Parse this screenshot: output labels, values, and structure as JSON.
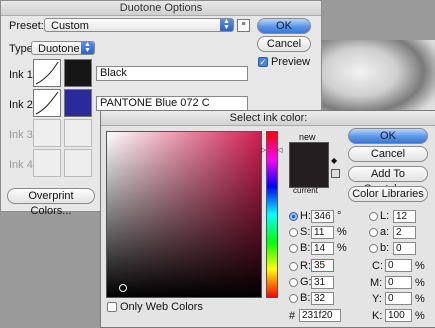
{
  "duotone": {
    "title": "Duotone Options",
    "preset_label": "Preset:",
    "preset_value": "Custom",
    "type_label": "Type:",
    "type_value": "Duotone",
    "ink1_label": "Ink 1:",
    "ink1_name": "Black",
    "ink2_label": "Ink 2:",
    "ink2_name": "PANTONE Blue 072 C",
    "ink3_label": "Ink 3:",
    "ink4_label": "Ink 4:",
    "ok": "OK",
    "cancel": "Cancel",
    "preview_label": "Preview",
    "preview_checked": true,
    "overprint": "Overprint Colors..."
  },
  "picker": {
    "title": "Select ink color:",
    "new_label": "new",
    "current_label": "current",
    "ok": "OK",
    "cancel": "Cancel",
    "add_swatches": "Add To Swatches",
    "color_libraries": "Color Libraries",
    "only_web": "Only Web Colors",
    "hsb": {
      "H_label": "H:",
      "H": "346",
      "H_unit": "°",
      "S_label": "S:",
      "S": "11",
      "S_unit": "%",
      "B_label": "B:",
      "B": "14",
      "B_unit": "%"
    },
    "rgb": {
      "R_label": "R:",
      "R": "35",
      "G_label": "G:",
      "G": "31",
      "B_label": "B:",
      "B": "32"
    },
    "lab": {
      "L_label": "L:",
      "L": "12",
      "a_label": "a:",
      "a": "2",
      "b_label": "b:",
      "b": "0"
    },
    "cmyk": {
      "C_label": "C:",
      "C": "0",
      "M_label": "M:",
      "M": "0",
      "Y_label": "Y:",
      "Y": "0",
      "K_label": "K:",
      "K": "100",
      "unit": "%"
    },
    "hex_label": "#",
    "hex": "231f20",
    "new_color": "#231f20",
    "current_color": "#231f20"
  },
  "colors": {
    "ink1": "#161616",
    "ink2": "#2a2a9a",
    "accent": "#3a78d6"
  }
}
